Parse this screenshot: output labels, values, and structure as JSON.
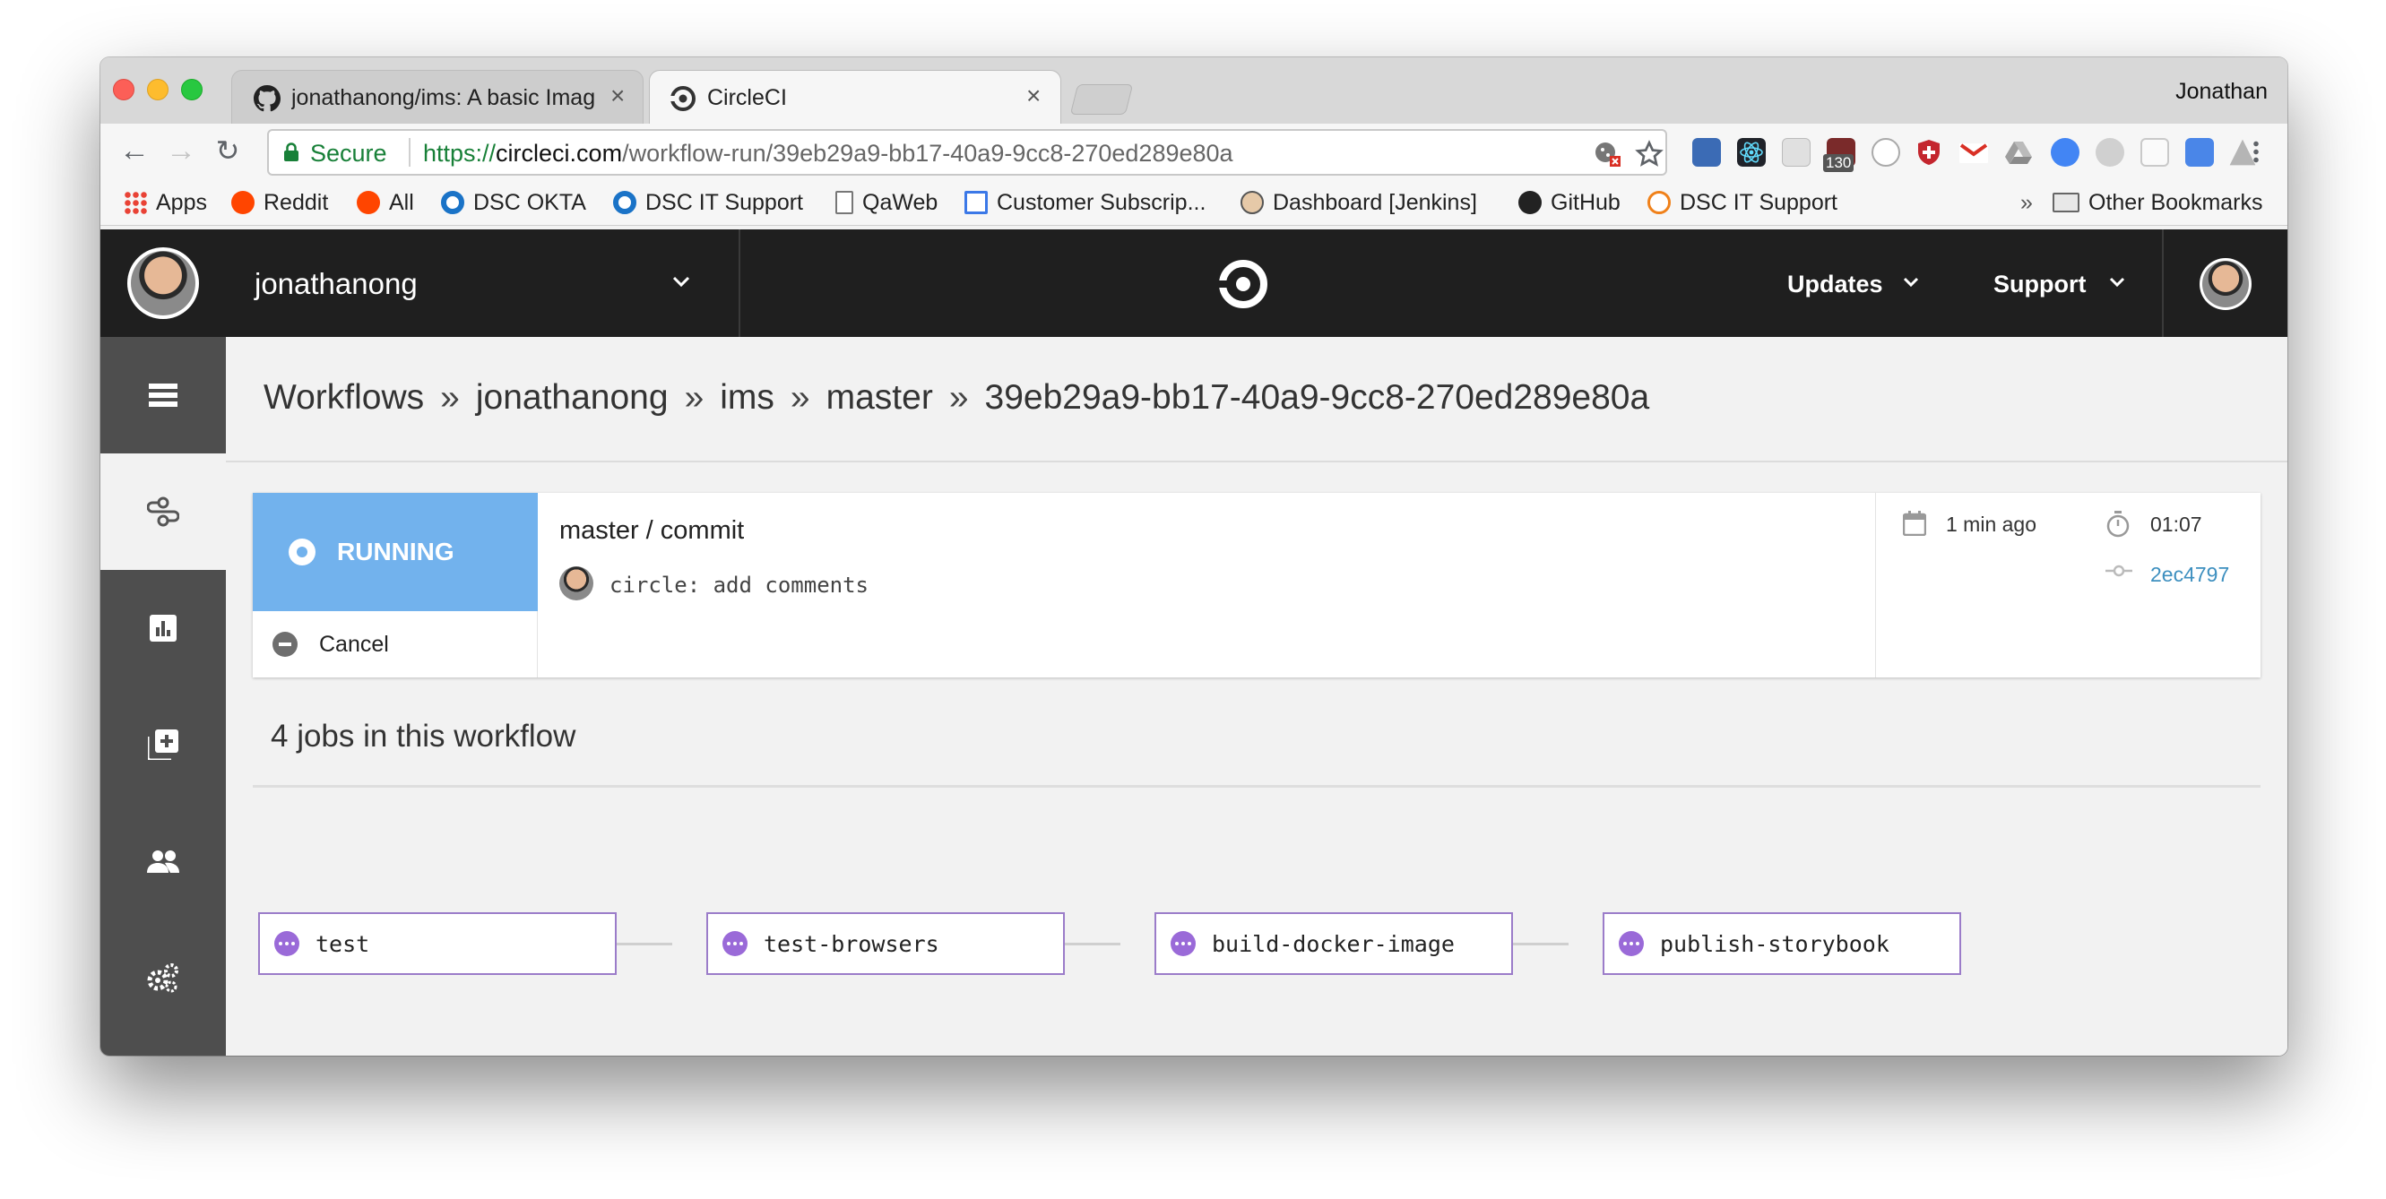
{
  "browser": {
    "tabs": [
      {
        "title": "jonathanong/ims: A basic Imag",
        "close": "×"
      },
      {
        "title": "CircleCI",
        "close": "×"
      }
    ],
    "profile_name": "Jonathan",
    "secure_label": "Secure",
    "url_scheme": "https://",
    "url_host": "circleci.com",
    "url_path": "/workflow-run/39eb29a9-bb17-40a9-9cc8-270ed289e80a",
    "extension_badge": "130",
    "bookmarks": [
      {
        "label": "Apps",
        "icon": "apps-grid-icon",
        "color": "#e94235"
      },
      {
        "label": "Reddit",
        "icon": "reddit-icon",
        "color": "#ff4500"
      },
      {
        "label": "All",
        "icon": "reddit-icon",
        "color": "#ff4500"
      },
      {
        "label": "DSC OKTA",
        "icon": "okta-icon",
        "color": "#1a73c7"
      },
      {
        "label": "DSC IT Support",
        "icon": "okta-icon",
        "color": "#1a73c7"
      },
      {
        "label": "QaWeb",
        "icon": "page-icon",
        "color": "#ffffff"
      },
      {
        "label": "Customer Subscrip...",
        "icon": "table-icon",
        "color": "#3b78e7"
      },
      {
        "label": "Dashboard [Jenkins]",
        "icon": "jenkins-icon",
        "color": "#d24939"
      },
      {
        "label": "GitHub",
        "icon": "github-icon",
        "color": "#222222"
      },
      {
        "label": "DSC IT Support",
        "icon": "tools-icon",
        "color": "#f0811a"
      }
    ],
    "overflow": "»",
    "other_bookmarks": "Other Bookmarks"
  },
  "header": {
    "org_name": "jonathanong",
    "updates_label": "Updates",
    "support_label": "Support"
  },
  "breadcrumb": {
    "items": [
      "Workflows",
      "jonathanong",
      "ims",
      "master",
      "39eb29a9-bb17-40a9-9cc8-270ed289e80a"
    ],
    "separator": "»"
  },
  "workflow": {
    "status": "RUNNING",
    "status_color": "#72b2ed",
    "cancel_label": "Cancel",
    "branch_commit": "master / commit",
    "commit_message": "circle: add comments",
    "time_ago": "1 min ago",
    "duration": "01:07",
    "commit_hash": "2ec4797"
  },
  "jobs": {
    "heading": "4 jobs in this workflow",
    "items": [
      {
        "name": "test"
      },
      {
        "name": "test-browsers"
      },
      {
        "name": "build-docker-image"
      },
      {
        "name": "publish-storybook"
      }
    ],
    "accent": "#9a6ad8"
  },
  "sidebar": {
    "items": [
      {
        "icon": "builds-list-icon"
      },
      {
        "icon": "workflows-icon",
        "active": true
      },
      {
        "icon": "insights-chart-icon"
      },
      {
        "icon": "add-project-icon"
      },
      {
        "icon": "team-icon"
      },
      {
        "icon": "settings-gears-icon"
      }
    ]
  }
}
